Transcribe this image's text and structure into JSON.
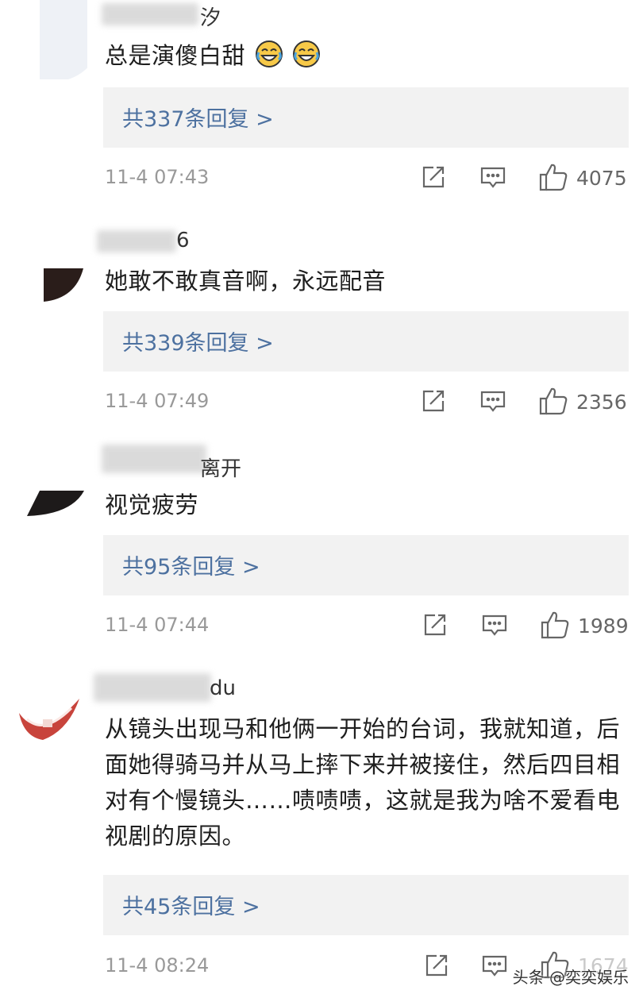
{
  "comments": [
    {
      "username_visible": "汐",
      "text": "总是演傻白甜",
      "emoji_icon": "laughing-crying-emoji",
      "replies_label": "共337条回复 >",
      "timestamp": "11-4 07:43",
      "likes": "4075"
    },
    {
      "username_visible": "6",
      "text": "她敢不敢真音啊，永远配音",
      "replies_label": "共339条回复 >",
      "timestamp": "11-4 07:49",
      "likes": "2356"
    },
    {
      "username_visible": "离开",
      "text": "视觉疲劳",
      "replies_label": "共95条回复 >",
      "timestamp": "11-4 07:44",
      "likes": "1989"
    },
    {
      "username_visible": "du",
      "text": "从镜头出现马和他俩一开始的台词，我就知道，后面她得骑马并从马上摔下来并被接住，然后四目相对有个慢镜头……啧啧啧，这就是我为啥不爱看电视剧的原因。",
      "replies_label": "共45条回复 >",
      "timestamp": "11-4 08:24",
      "likes": "1674"
    }
  ],
  "watermark": "头条 @奕奕娱乐",
  "icons": {
    "repost": "share-icon",
    "comment": "comment-icon",
    "like": "thumbs-up-icon"
  },
  "colors": {
    "reply_link": "#4d71a0",
    "reply_bg": "#f2f2f2",
    "timestamp": "#999999"
  }
}
